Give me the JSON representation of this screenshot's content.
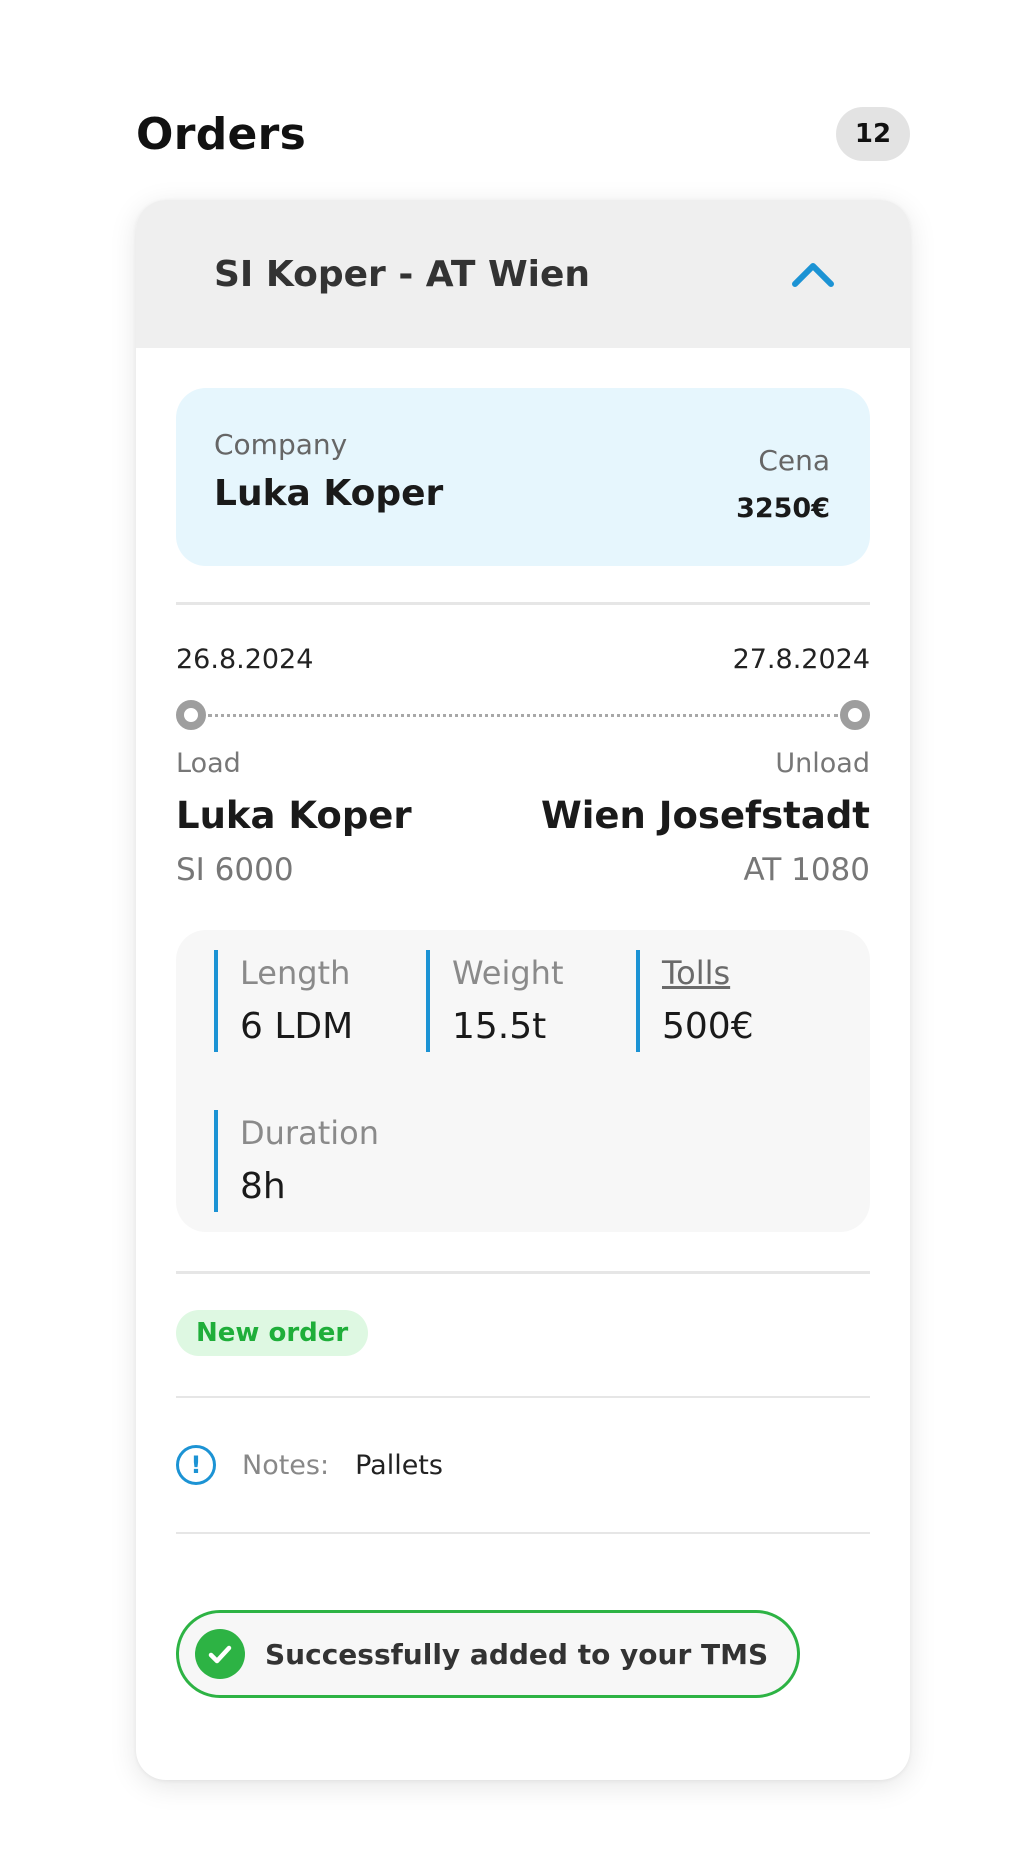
{
  "header": {
    "title": "Orders",
    "count": "12"
  },
  "order": {
    "route_title": "SI Koper - AT Wien",
    "company": {
      "label": "Company",
      "name": "Luka Koper",
      "price_label": "Cena",
      "price_value": "3250€"
    },
    "dates": {
      "load_date": "26.8.2024",
      "unload_date": "27.8.2024"
    },
    "load": {
      "label": "Load",
      "place": "Luka Koper",
      "code": "SI 6000"
    },
    "unload": {
      "label": "Unload",
      "place": "Wien Josefstadt",
      "code": "AT 1080"
    },
    "specs": [
      {
        "label": "Length",
        "value": "6 LDM"
      },
      {
        "label": "Weight",
        "value": "15.5t"
      },
      {
        "label": "Tolls",
        "value": "500€"
      },
      {
        "label": "Duration",
        "value": "8h"
      }
    ],
    "status": "New order",
    "notes": {
      "label": "Notes:",
      "value": "Pallets"
    },
    "success_message": "Successfully added to your TMS"
  },
  "icons": {
    "collapse": "chevron-up-icon",
    "notes": "info-icon",
    "success": "check-circle-icon"
  },
  "colors": {
    "accent": "#1c93d4",
    "success": "#2db344",
    "status_bg": "#def8e2",
    "status_text": "#1fae3a",
    "company_bg": "#e6f6fd",
    "header_bg": "#efefef"
  }
}
